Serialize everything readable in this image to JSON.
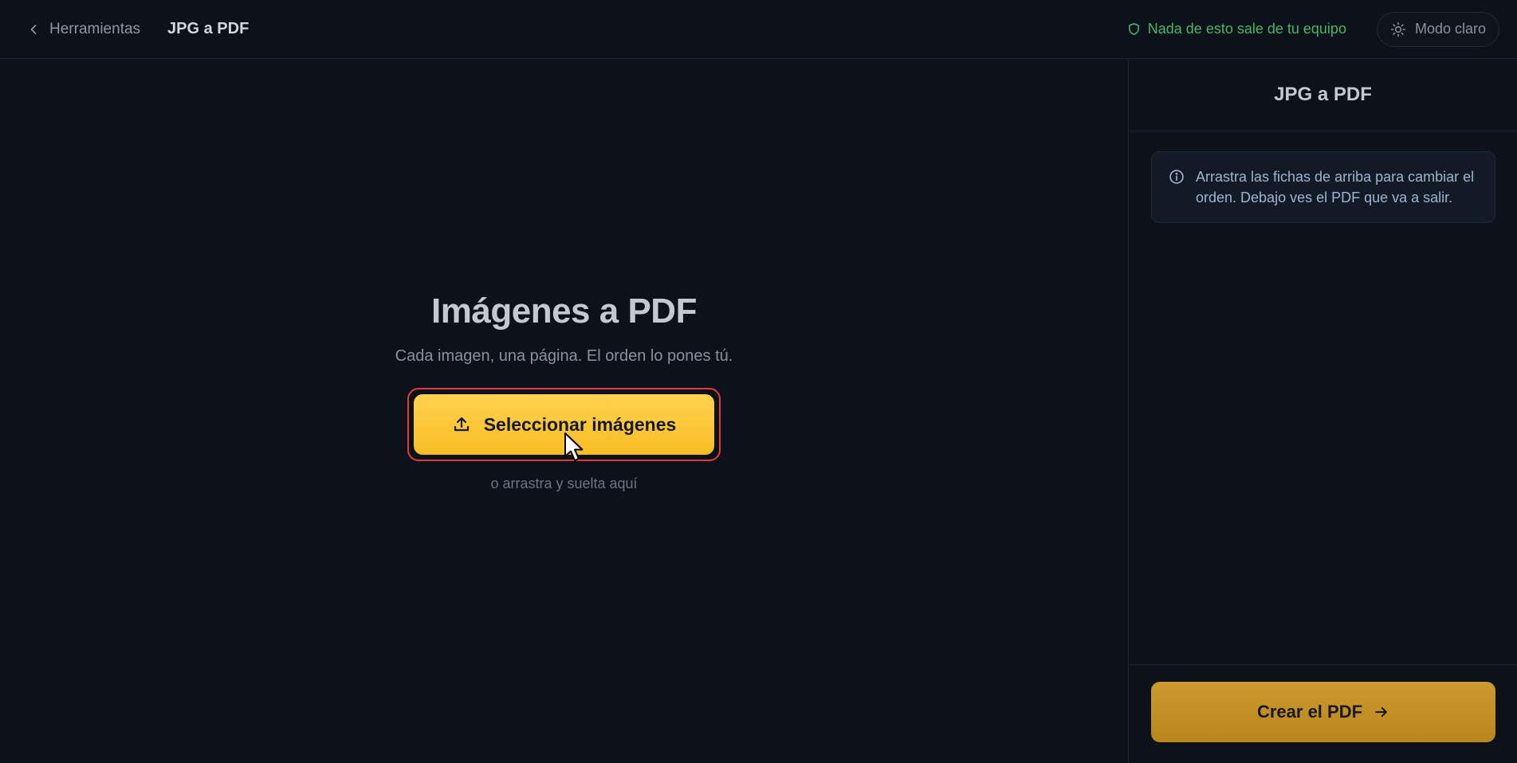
{
  "header": {
    "back_label": "Herramientas",
    "back_icon": "chevron-left-icon",
    "current": "JPG a PDF",
    "privacy_text": "Nada de esto sale de tu equipo",
    "privacy_icon": "shield-icon",
    "mode_label": "Modo claro",
    "mode_icon": "sun-icon"
  },
  "main": {
    "title": "Imágenes a PDF",
    "subtitle": "Cada imagen, una página. El orden lo pones tú.",
    "select_label": "Seleccionar imágenes",
    "select_icon": "upload-icon",
    "drop_hint": "o arrastra y suelta aquí"
  },
  "panel": {
    "title": "JPG a PDF",
    "info_text": "Arrastra las fichas de arriba para cambiar el orden. Debajo ves el PDF que va a salir.",
    "info_icon": "info-icon",
    "create_label": "Crear el PDF",
    "create_icon": "arrow-right-icon"
  },
  "colors": {
    "background": "#0d1119",
    "accent": "#f8bd22",
    "accent_muted": "#b8861c",
    "privacy_green": "#43b867",
    "highlight_red": "#e23b3b"
  }
}
